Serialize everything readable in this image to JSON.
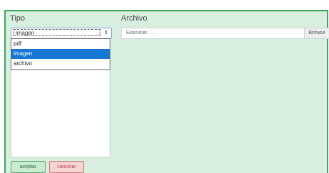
{
  "form": {
    "tipo_label": "Tipo",
    "archivo_label": "Archivo",
    "tipo_selected": "imagen",
    "tipo_options": [
      "pdf",
      "imagen",
      "archivo"
    ],
    "file_placeholder": "Examinar . . .",
    "browse_label": "Browse",
    "accept_label": "aceptar",
    "cancel_label": "cancelar"
  },
  "colors": {
    "panel_bg": "#d8eedf",
    "panel_border": "#3aa85c",
    "selected_option": "#1577d4",
    "accept_bg": "#c9ebd2",
    "cancel_bg": "#f7d3d3"
  },
  "icons": {
    "select_arrow": "updown-caret-icon"
  }
}
